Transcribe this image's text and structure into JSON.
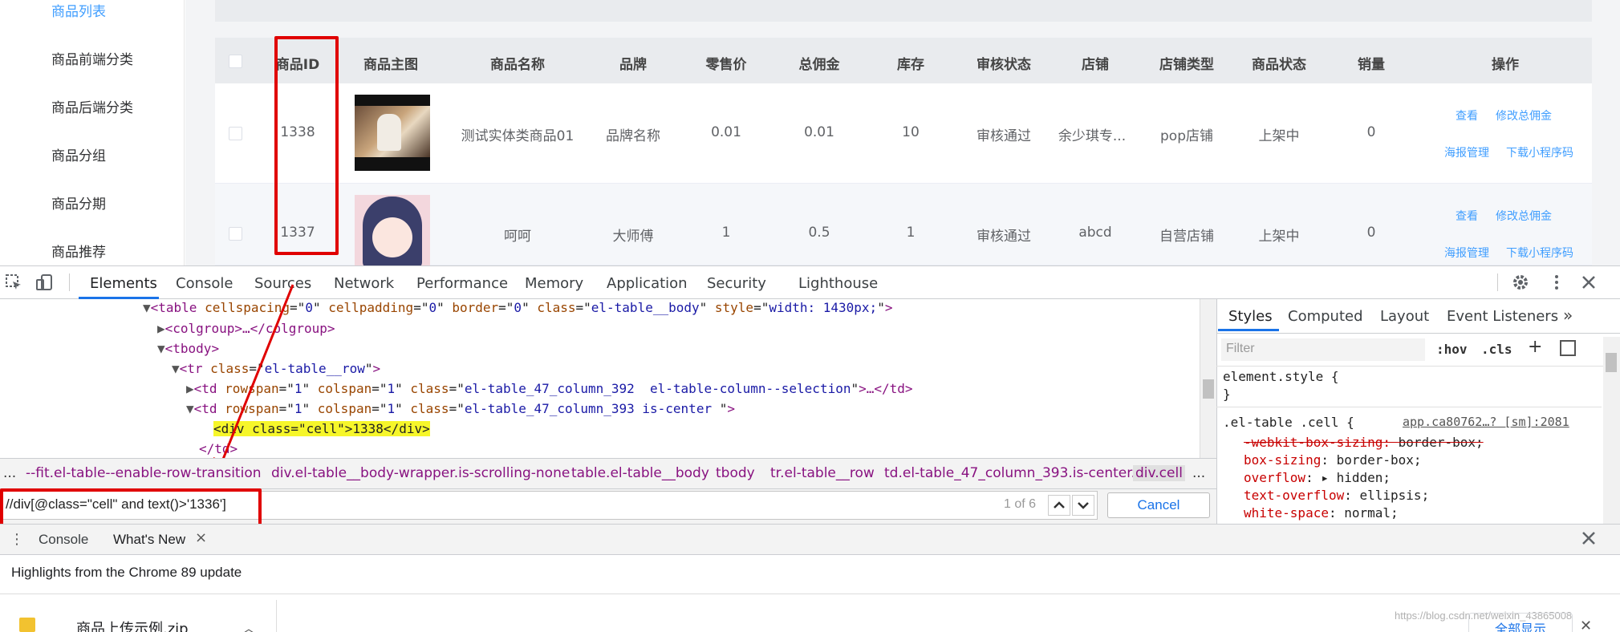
{
  "sidebar": {
    "items": [
      "商品列表",
      "商品前端分类",
      "商品后端分类",
      "商品分组",
      "商品分期",
      "商品推荐"
    ]
  },
  "table": {
    "headers": [
      "商品ID",
      "商品主图",
      "商品名称",
      "品牌",
      "零售价",
      "总佣金",
      "库存",
      "审核状态",
      "店铺",
      "店铺类型",
      "商品状态",
      "销量",
      "操作"
    ],
    "rows": [
      {
        "id": "1338",
        "name": "测试实体类商品01",
        "brand": "品牌名称",
        "price": "0.01",
        "commission": "0.01",
        "stock": "10",
        "audit": "审核通过",
        "shop": "余少琪专...",
        "shop_type": "pop店铺",
        "status": "上架中",
        "sales": "0",
        "ops": [
          "查看",
          "修改总佣金",
          "海报管理",
          "下载小程序码"
        ]
      },
      {
        "id": "1337",
        "name": "呵呵",
        "brand": "大师傅",
        "price": "1",
        "commission": "0.5",
        "stock": "1",
        "audit": "审核通过",
        "shop": "abcd",
        "shop_type": "自营店铺",
        "status": "上架中",
        "sales": "0",
        "ops": [
          "查看",
          "修改总佣金",
          "海报管理",
          "下载小程序码"
        ]
      }
    ]
  },
  "devtools": {
    "tabs": [
      "Elements",
      "Console",
      "Sources",
      "Network",
      "Performance",
      "Memory",
      "Application",
      "Security",
      "Lighthouse"
    ],
    "code": {
      "l1_a": "<table ",
      "l1_b": "cellspacing",
      "l1_c": "=\"",
      "l1_d": "0",
      "l1_e": "\" ",
      "l1_f": "cellpadding",
      "l1_g": "0",
      "l1_h": "border",
      "l1_i": "0",
      "l1_j": "class",
      "l1_k": "el-table__body",
      "l1_l": "style",
      "l1_m": "width: 1430px;",
      "l1_n": ">",
      "l2": "<colgroup>…</colgroup>",
      "l3": "<tbody>",
      "l4_a": "<tr ",
      "l4_b": "class",
      "l4_c": "el-table__row",
      "l4_d": ">",
      "l5_a": "<td ",
      "l5_b": "rowspan",
      "l5_c": "1",
      "l5_d": "colspan",
      "l5_e": "1",
      "l5_f": "class",
      "l5_g": "el-table_47_column_392  el-table-column--selection",
      "l5_h": ">…</td>",
      "l6_a": "<td ",
      "l6_b": "rowspan",
      "l6_c": "1",
      "l6_d": "colspan",
      "l6_e": "1",
      "l6_f": "class",
      "l6_g": "el-table_47_column_393 is-center ",
      "l6_h": ">",
      "l7": "<div class=\"cell\">1338</div>",
      "l8": "</td>"
    },
    "breadcrumbs": [
      "...",
      "--fit.el-table--enable-row-transition",
      "div.el-table__body-wrapper.is-scrolling-none",
      "table.el-table__body",
      "tbody",
      "tr.el-table__row",
      "td.el-table_47_column_393.is-center.",
      "div.cell",
      "..."
    ],
    "search": {
      "value": "//div[@class=\"cell\" and text()>'1336']",
      "count": "1 of 6",
      "cancel": "Cancel"
    },
    "styles": {
      "tabs": [
        "Styles",
        "Computed",
        "Layout",
        "Event Listeners"
      ],
      "filter_placeholder": "Filter",
      "hov": ":hov",
      "cls": ".cls",
      "element_style": "element.style {",
      "close_brace": "}",
      "selector": ".el-table .cell {",
      "source": "app.ca80762…? [sm]:2081",
      "props": [
        {
          "name": "-webkit-box-sizing",
          "value": "border-box;"
        },
        {
          "name": "box-sizing",
          "value": "border-box;"
        },
        {
          "name": "overflow",
          "value": "hidden;"
        },
        {
          "name": "text-overflow",
          "value": "ellipsis;"
        },
        {
          "name": "white-space",
          "value": "normal;"
        }
      ]
    },
    "drawer": {
      "tabs": [
        "Console",
        "What's New"
      ],
      "message": "Highlights from the Chrome 89 update"
    }
  },
  "downloads": {
    "file": "商品上传示例.zip",
    "show_all": "全部显示",
    "watermark": "https://blog.csdn.net/weixin_43865008"
  },
  "colors": {
    "accent": "#409eff",
    "annotation": "#e00000",
    "devtools_tab_active": "#1a73e8"
  }
}
